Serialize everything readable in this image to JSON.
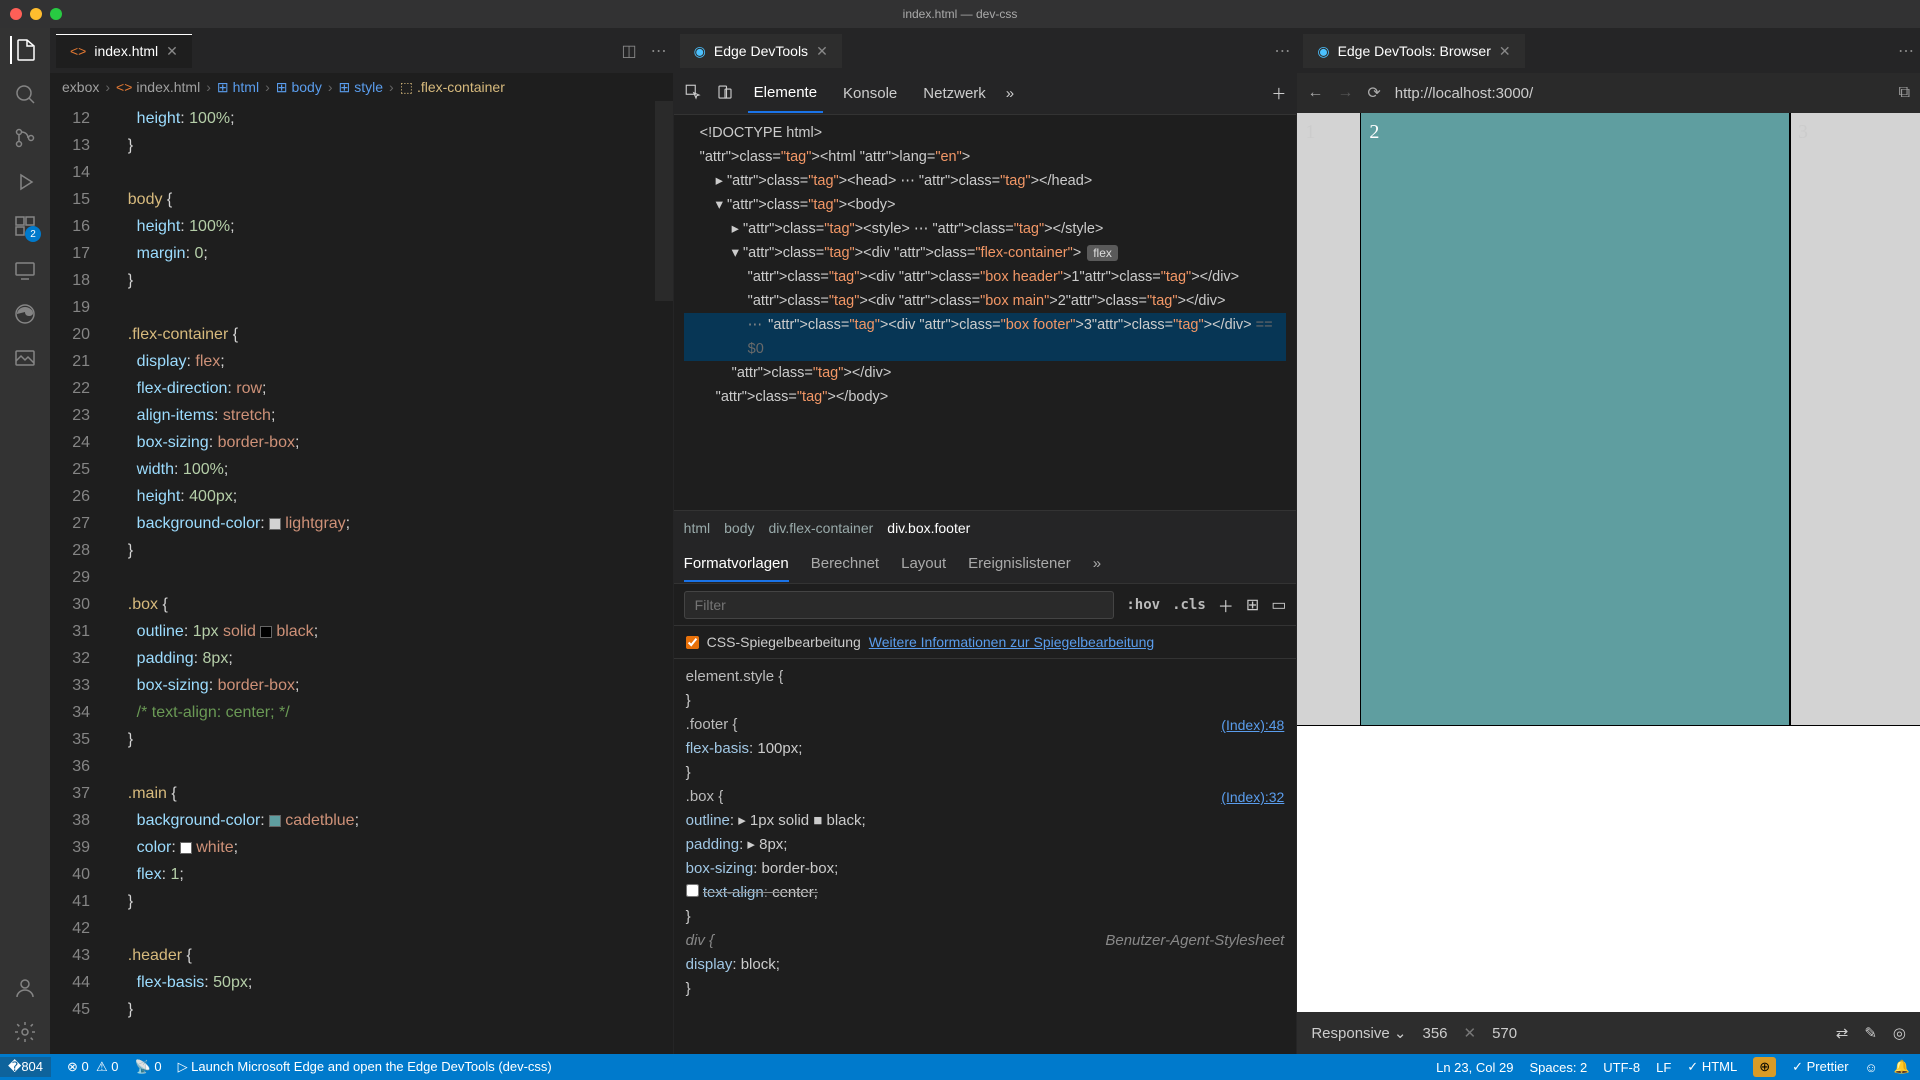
{
  "titlebar": {
    "title": "index.html — dev-css"
  },
  "activity": {
    "ext_badge": "2"
  },
  "editor_tab": {
    "filename": "index.html"
  },
  "breadcrumbs": [
    "exbox",
    "index.html",
    "html",
    "body",
    "style",
    ".flex-container"
  ],
  "code_lines": [
    {
      "n": 12,
      "text": "      height: 100%;",
      "tokens": [
        [
          "      ",
          ""
        ],
        [
          "height",
          "prop"
        ],
        [
          ": ",
          ""
        ],
        [
          "100%",
          "num"
        ],
        [
          ";",
          ""
        ]
      ]
    },
    {
      "n": 13,
      "text": "    }",
      "tokens": [
        [
          "    }",
          ""
        ]
      ]
    },
    {
      "n": 14,
      "text": "",
      "tokens": []
    },
    {
      "n": 15,
      "text": "    body {",
      "tokens": [
        [
          "    ",
          ""
        ],
        [
          "body",
          "sel"
        ],
        [
          " {",
          ""
        ]
      ]
    },
    {
      "n": 16,
      "text": "      height: 100%;",
      "tokens": [
        [
          "      ",
          ""
        ],
        [
          "height",
          "prop"
        ],
        [
          ": ",
          ""
        ],
        [
          "100%",
          "num"
        ],
        [
          ";",
          ""
        ]
      ]
    },
    {
      "n": 17,
      "text": "      margin: 0;",
      "tokens": [
        [
          "      ",
          ""
        ],
        [
          "margin",
          "prop"
        ],
        [
          ": ",
          ""
        ],
        [
          "0",
          "num"
        ],
        [
          ";",
          ""
        ]
      ]
    },
    {
      "n": 18,
      "text": "    }",
      "tokens": [
        [
          "    }",
          ""
        ]
      ]
    },
    {
      "n": 19,
      "text": "",
      "tokens": []
    },
    {
      "n": 20,
      "text": "    .flex-container {",
      "tokens": [
        [
          "    ",
          ""
        ],
        [
          ".flex-container",
          "sel"
        ],
        [
          " {",
          ""
        ]
      ]
    },
    {
      "n": 21,
      "text": "      display: flex;",
      "tokens": [
        [
          "      ",
          ""
        ],
        [
          "display",
          "prop"
        ],
        [
          ": ",
          ""
        ],
        [
          "flex",
          "val"
        ],
        [
          ";",
          ""
        ]
      ]
    },
    {
      "n": 22,
      "text": "      flex-direction: row;",
      "tokens": [
        [
          "      ",
          ""
        ],
        [
          "flex-direction",
          "prop"
        ],
        [
          ": ",
          ""
        ],
        [
          "row",
          "val"
        ],
        [
          ";",
          ""
        ]
      ]
    },
    {
      "n": 23,
      "text": "      align-items: stretch;",
      "tokens": [
        [
          "      ",
          ""
        ],
        [
          "align-items",
          "prop"
        ],
        [
          ": ",
          ""
        ],
        [
          "stretch",
          "val"
        ],
        [
          ";",
          ""
        ]
      ]
    },
    {
      "n": 24,
      "text": "      box-sizing: border-box;",
      "tokens": [
        [
          "      ",
          ""
        ],
        [
          "box-sizing",
          "prop"
        ],
        [
          ": ",
          ""
        ],
        [
          "border-box",
          "val"
        ],
        [
          ";",
          ""
        ]
      ]
    },
    {
      "n": 25,
      "text": "      width: 100%;",
      "tokens": [
        [
          "      ",
          ""
        ],
        [
          "width",
          "prop"
        ],
        [
          ": ",
          ""
        ],
        [
          "100%",
          "num"
        ],
        [
          ";",
          ""
        ]
      ]
    },
    {
      "n": 26,
      "text": "      height: 400px;",
      "tokens": [
        [
          "      ",
          ""
        ],
        [
          "height",
          "prop"
        ],
        [
          ": ",
          ""
        ],
        [
          "400px",
          "num"
        ],
        [
          ";",
          ""
        ]
      ]
    },
    {
      "n": 27,
      "text": "      background-color: lightgray;",
      "tokens": [
        [
          "      ",
          ""
        ],
        [
          "background-color",
          "prop"
        ],
        [
          ": ",
          ""
        ],
        [
          "■",
          "sw",
          "#d3d3d3"
        ],
        [
          "lightgray",
          "val"
        ],
        [
          ";",
          ""
        ]
      ]
    },
    {
      "n": 28,
      "text": "    }",
      "tokens": [
        [
          "    }",
          ""
        ]
      ]
    },
    {
      "n": 29,
      "text": "",
      "tokens": []
    },
    {
      "n": 30,
      "text": "    .box {",
      "tokens": [
        [
          "    ",
          ""
        ],
        [
          ".box",
          "sel"
        ],
        [
          " {",
          ""
        ]
      ]
    },
    {
      "n": 31,
      "text": "      outline: 1px solid black;",
      "tokens": [
        [
          "      ",
          ""
        ],
        [
          "outline",
          "prop"
        ],
        [
          ": ",
          ""
        ],
        [
          "1px",
          "num"
        ],
        [
          " ",
          ""
        ],
        [
          "solid",
          "val"
        ],
        [
          " ",
          ""
        ],
        [
          "■",
          "sw",
          "#000"
        ],
        [
          "black",
          "val"
        ],
        [
          ";",
          ""
        ]
      ]
    },
    {
      "n": 32,
      "text": "      padding: 8px;",
      "tokens": [
        [
          "      ",
          ""
        ],
        [
          "padding",
          "prop"
        ],
        [
          ": ",
          ""
        ],
        [
          "8px",
          "num"
        ],
        [
          ";",
          ""
        ]
      ]
    },
    {
      "n": 33,
      "text": "      box-sizing: border-box;",
      "tokens": [
        [
          "      ",
          ""
        ],
        [
          "box-sizing",
          "prop"
        ],
        [
          ": ",
          ""
        ],
        [
          "border-box",
          "val"
        ],
        [
          ";",
          ""
        ]
      ]
    },
    {
      "n": 34,
      "text": "      /* text-align: center; */",
      "tokens": [
        [
          "      ",
          ""
        ],
        [
          "/* text-align: center; */",
          "cm"
        ]
      ]
    },
    {
      "n": 35,
      "text": "    }",
      "tokens": [
        [
          "    }",
          ""
        ]
      ]
    },
    {
      "n": 36,
      "text": "",
      "tokens": []
    },
    {
      "n": 37,
      "text": "    .main {",
      "tokens": [
        [
          "    ",
          ""
        ],
        [
          ".main",
          "sel"
        ],
        [
          " {",
          ""
        ]
      ]
    },
    {
      "n": 38,
      "text": "      background-color: cadetblue;",
      "tokens": [
        [
          "      ",
          ""
        ],
        [
          "background-color",
          "prop"
        ],
        [
          ": ",
          ""
        ],
        [
          "■",
          "sw",
          "#5f9ea0"
        ],
        [
          "cadetblue",
          "val"
        ],
        [
          ";",
          ""
        ]
      ]
    },
    {
      "n": 39,
      "text": "      color: white;",
      "tokens": [
        [
          "      ",
          ""
        ],
        [
          "color",
          "prop"
        ],
        [
          ": ",
          ""
        ],
        [
          "■",
          "sw",
          "#fff"
        ],
        [
          "white",
          "val"
        ],
        [
          ";",
          ""
        ]
      ]
    },
    {
      "n": 40,
      "text": "      flex: 1;",
      "tokens": [
        [
          "      ",
          ""
        ],
        [
          "flex",
          "prop"
        ],
        [
          ": ",
          ""
        ],
        [
          "1",
          "num"
        ],
        [
          ";",
          ""
        ]
      ]
    },
    {
      "n": 41,
      "text": "    }",
      "tokens": [
        [
          "    }",
          ""
        ]
      ]
    },
    {
      "n": 42,
      "text": "",
      "tokens": []
    },
    {
      "n": 43,
      "text": "    .header {",
      "tokens": [
        [
          "    ",
          ""
        ],
        [
          ".header",
          "sel"
        ],
        [
          " {",
          ""
        ]
      ]
    },
    {
      "n": 44,
      "text": "      flex-basis: 50px;",
      "tokens": [
        [
          "      ",
          ""
        ],
        [
          "flex-basis",
          "prop"
        ],
        [
          ": ",
          ""
        ],
        [
          "50px",
          "num"
        ],
        [
          ";",
          ""
        ]
      ]
    },
    {
      "n": 45,
      "text": "    }",
      "tokens": [
        [
          "    }",
          ""
        ]
      ]
    }
  ],
  "devtools": {
    "title": "Edge DevTools",
    "tabs": [
      "Elemente",
      "Konsole",
      "Netzwerk"
    ],
    "elements_crumbs": [
      "html",
      "body",
      "div.flex-container",
      "div.box.footer"
    ],
    "styles_tabs": [
      "Formatvorlagen",
      "Berechnet",
      "Layout",
      "Ereignislistener"
    ],
    "filter_placeholder": "Filter",
    "hov": ":hov",
    "cls": ".cls",
    "mirror_label": "CSS-Spiegelbearbeitung",
    "mirror_link": "Weitere Informationen zur Spiegelbearbeitung",
    "rules": {
      "element_style": "element.style {",
      "footer_sel": ".footer {",
      "footer_link": "(Index):48",
      "footer_body": "    flex-basis: 100px;",
      "box_sel": ".box {",
      "box_link": "(Index):32",
      "box_body": [
        "    outline: ▸ 1px solid ■ black;",
        "    padding: ▸ 8px;",
        "    box-sizing: border-box;",
        "    text-align: center;"
      ],
      "ua_sel": "div {",
      "ua_label": "Benutzer-Agent-Stylesheet",
      "ua_body": "    display: block;"
    },
    "dom": {
      "doctype": "<!DOCTYPE html>",
      "html": "<html lang=\"en\">",
      "head": "<head> ⋯ </head>",
      "body_open": "<body>",
      "style": "<style> ⋯ </style>",
      "flex": "<div class=\"flex-container\">",
      "c1": "<div class=\"box header\">1</div>",
      "c2": "<div class=\"box main\">2</div>",
      "c3": "<div class=\"box footer\">3</div>",
      "eq": " == $0",
      "flex_close": "</div>",
      "body_close": "</body>"
    }
  },
  "browser": {
    "title": "Edge DevTools: Browser",
    "url": "http://localhost:3000/",
    "boxes": [
      "1",
      "2",
      "3"
    ],
    "device": {
      "mode": "Responsive",
      "w": "356",
      "h": "570"
    }
  },
  "status": {
    "remote_icon": "⎇",
    "errors": "0",
    "warnings": "0",
    "ports": "0",
    "launch": "Launch Microsoft Edge and open the Edge DevTools (dev-css)",
    "pos": "Ln 23, Col 29",
    "spaces": "Spaces: 2",
    "enc": "UTF-8",
    "eol": "LF",
    "lang": "HTML",
    "prettier": "Prettier"
  }
}
